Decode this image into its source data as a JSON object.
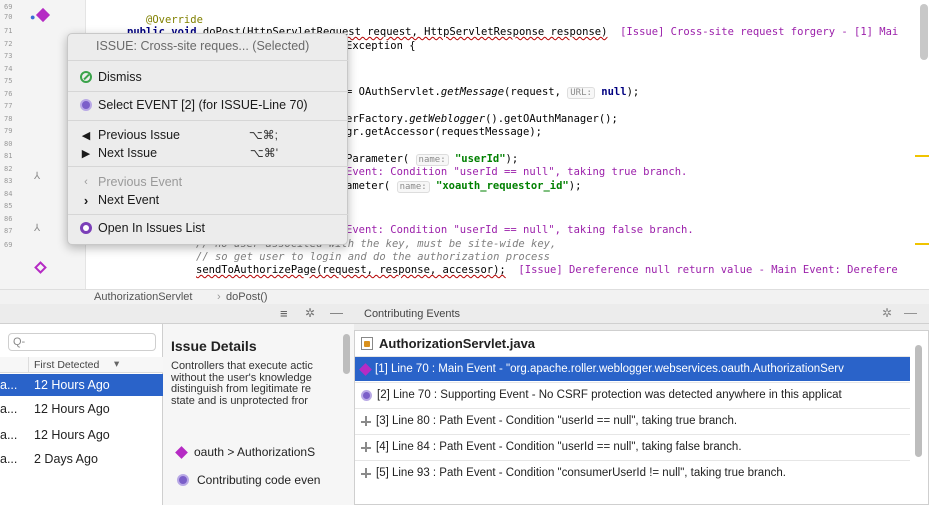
{
  "editor": {
    "line_numbers": [
      "69",
      "70",
      "71",
      "72",
      "73",
      "74",
      "75",
      "76",
      "77",
      "78",
      "79",
      "80",
      "81",
      "82",
      "83",
      "84",
      "85",
      "86",
      "87"
    ],
    "code": {
      "l69": "@Override",
      "l70_kw": "public void",
      "l70_sig": " doPost(HttpServletRequest request, HttpServletResponse response)",
      "l70_issue": "[Issue] Cross-site request forgery - [1] Mai",
      "l71": "Exception {",
      "l74_a": "= OAuthServlet.",
      "l74_m": "getMessage",
      "l74_b": "(request, ",
      "l74_hint": "URL:",
      "l74_null": "null",
      "l74_c": ");",
      "l76_a": "erFactory.",
      "l76_m": "getWeblogger",
      "l76_b": "().getOAuthManager();",
      "l77": "gr.getAccessor(requestMessage);",
      "l79_a": "Parameter( ",
      "l79_hint": "name:",
      "l79_str": "\"userId\"",
      "l79_b": ");",
      "l80": "Event: Condition \"userId == null\", taking true branch.",
      "l81_a": "ameter( ",
      "l81_hint": "name:",
      "l81_str": "\"xoauth_requestor_id\"",
      "l81_b": ");",
      "l84": "Event: Condition \"userId == null\", taking false branch.",
      "l85": "// no user associted with the key, must be site-wide key,",
      "l86": "// so get user to login and do the authorization process",
      "l87_a": "sendToAuthorizePage(request, response, accessor);",
      "l87_issue": "[Issue] Dereference null return value - Main Event: Derefere"
    },
    "popup": {
      "header": "ISSUE: Cross-site reques... (Selected)",
      "dismiss": "Dismiss",
      "select_event": "Select EVENT [2] (for ISSUE-Line 70)",
      "previous_issue": "Previous Issue",
      "previous_issue_shortcut": "⌥⌘;",
      "next_issue": "Next Issue",
      "next_issue_shortcut": "⌥⌘'",
      "previous_event": "Previous Event",
      "next_event": "Next Event",
      "open_in_issues_list": "Open In Issues List"
    }
  },
  "breadcrumb": {
    "class": "AuthorizationServlet",
    "sep": "›",
    "method": "doPost()"
  },
  "issues_panel": {
    "search_placeholder": "Q-",
    "column_header": "First Detected",
    "sort_glyph": "▾",
    "rows": [
      {
        "c1": "a...",
        "detected": "12 Hours Ago",
        "selected": true
      },
      {
        "c1": "a...",
        "detected": "12 Hours Ago",
        "selected": false
      },
      {
        "c1": "a...",
        "detected": "12 Hours Ago",
        "selected": false
      },
      {
        "c1": "a...",
        "detected": "2 Days Ago",
        "selected": false
      }
    ]
  },
  "details_panel": {
    "title": "Issue Details",
    "desc_lines": [
      "Controllers that execute actic",
      "without the user's knowledge",
      "distinguish from legitimate re",
      "state and is unprotected fror"
    ],
    "link1": "oauth > AuthorizationS",
    "link2": "Contributing code even"
  },
  "events_panel": {
    "title": "Contributing Events",
    "file": "AuthorizationServlet.java",
    "events": [
      "[1] Line 70 : Main Event - \"org.apache.roller.weblogger.webservices.oauth.AuthorizationServ",
      "[2] Line 70 : Supporting Event - No CSRF protection was detected anywhere in this applicat",
      "[3] Line 80 : Path Event - Condition \"userId == null\", taking true branch.",
      "[4] Line 84 : Path Event - Condition \"userId == null\", taking false branch.",
      "[5] Line 93 : Path Event - Condition \"consumerUserId != null\", taking true branch."
    ]
  },
  "colors": {
    "selection": "#2a63c9",
    "issue_purple": "#9b1faa",
    "dismiss_green": "#3aa34a",
    "event_purple": "#7b5fc9"
  }
}
